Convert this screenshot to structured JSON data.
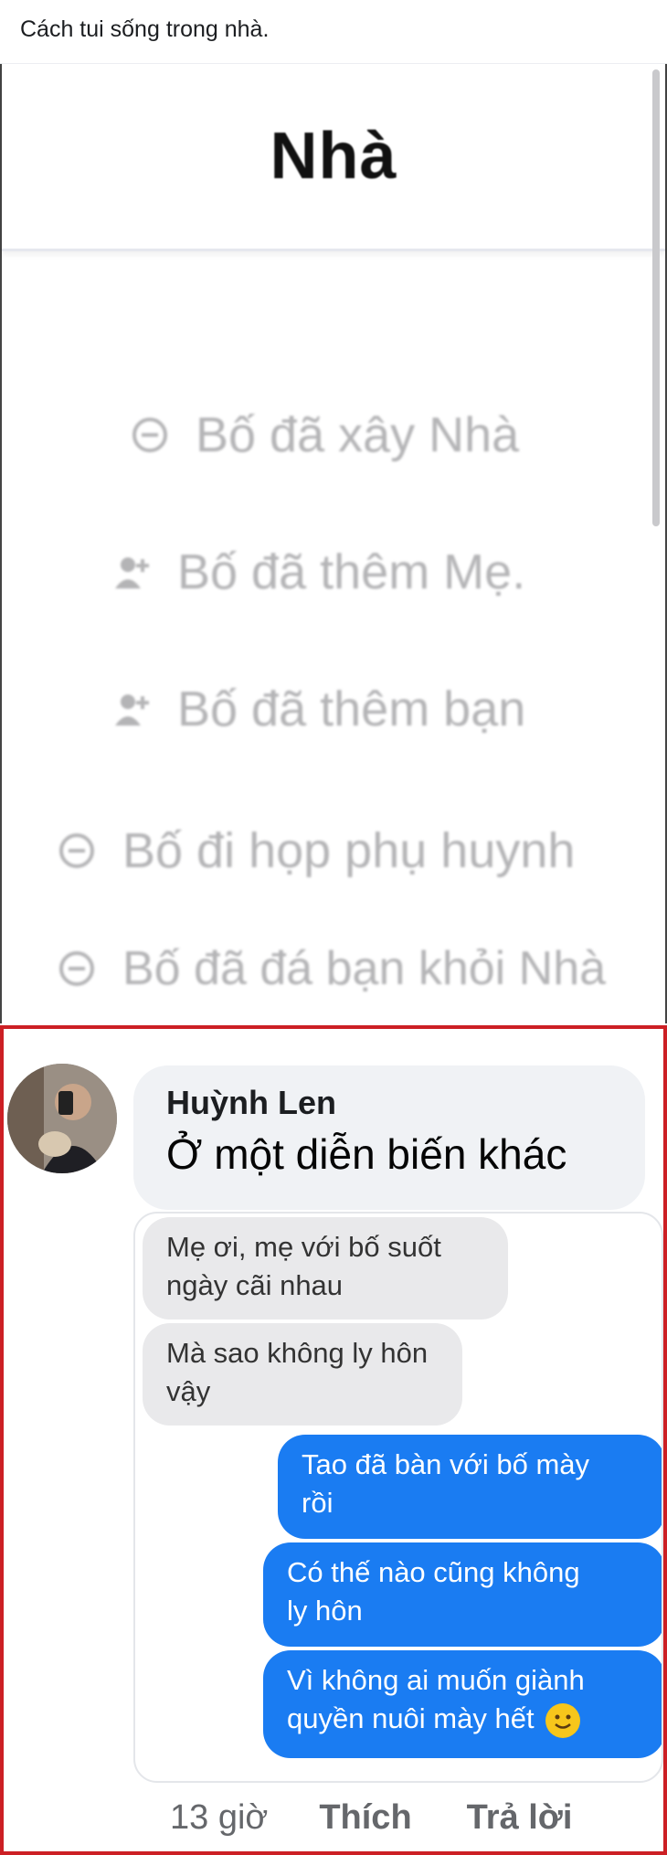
{
  "post": {
    "caption": "Cách tui sống trong nhà."
  },
  "screenshot": {
    "title": "Nhà",
    "activities": [
      {
        "icon": "minus-circle-icon",
        "text": "Bố đã xây Nhà"
      },
      {
        "icon": "add-person-icon",
        "text": "Bố đã thêm Mẹ."
      },
      {
        "icon": "add-person-icon",
        "text": "Bố đã thêm bạn"
      },
      {
        "icon": "minus-circle-icon",
        "text": "Bố đi họp phụ huynh"
      },
      {
        "icon": "minus-circle-icon",
        "text": "Bố đã đá bạn khỏi Nhà"
      }
    ]
  },
  "comment": {
    "author": "Huỳnh Len",
    "text": "Ở một diễn biến khác",
    "time": "13 giờ",
    "like_label": "Thích",
    "reply_label": "Trả lời",
    "messages": [
      {
        "side": "received",
        "line1": "Mẹ ơi, mẹ với bố suốt",
        "line2": "ngày cãi nhau"
      },
      {
        "side": "received",
        "line1": "Mà sao không ly hôn",
        "line2": "vậy"
      },
      {
        "side": "sent",
        "line1": "Tao đã bàn với bố mày",
        "line2": "rồi"
      },
      {
        "side": "sent",
        "line1": "Có thế nào cũng không",
        "line2": "ly hôn"
      },
      {
        "side": "sent",
        "line1": "Vì không ai muốn giành",
        "line2": "quyền nuôi mày hết"
      }
    ]
  },
  "colors": {
    "highlight_border": "#cc1f24",
    "sent_bubble": "#1a7cf2",
    "received_bubble": "#e9e9eb"
  }
}
